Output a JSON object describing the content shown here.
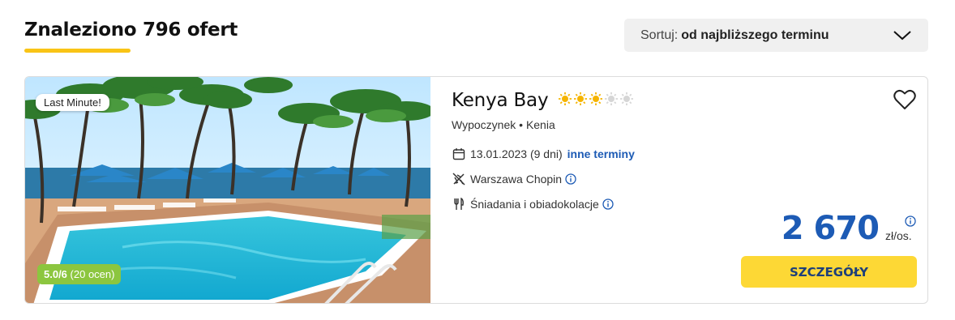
{
  "results": {
    "title": "Znaleziono 796 ofert"
  },
  "sort": {
    "label": "Sortuj:",
    "value": "od najbliższego terminu"
  },
  "offer": {
    "badge": "Last Minute!",
    "rating": {
      "score": "5.0/6",
      "count": "(20 ocen)"
    },
    "name": "Kenya Bay",
    "stars": {
      "filled": 3,
      "total": 5
    },
    "category": "Wypoczynek",
    "country": "Kenia",
    "date": "13.01.2023 (9 dni)",
    "other_dates_link": "inne terminy",
    "departure": "Warszawa Chopin",
    "board": "Śniadania i obiadokolacje",
    "price": "2 670",
    "price_unit": "zł/os.",
    "cta": "SZCZEGÓŁY"
  },
  "icons": {
    "sort": "chevron-down-icon",
    "date": "calendar-icon",
    "departure": "plane-icon",
    "board": "cutlery-icon",
    "info": "info-icon",
    "favorite": "heart-icon"
  },
  "colors": {
    "accent_yellow": "#fdd835",
    "link_blue": "#1d5bb5",
    "rating_green": "#8cc63f",
    "star_gold": "#f5b400",
    "star_empty": "#d6d6d6"
  }
}
